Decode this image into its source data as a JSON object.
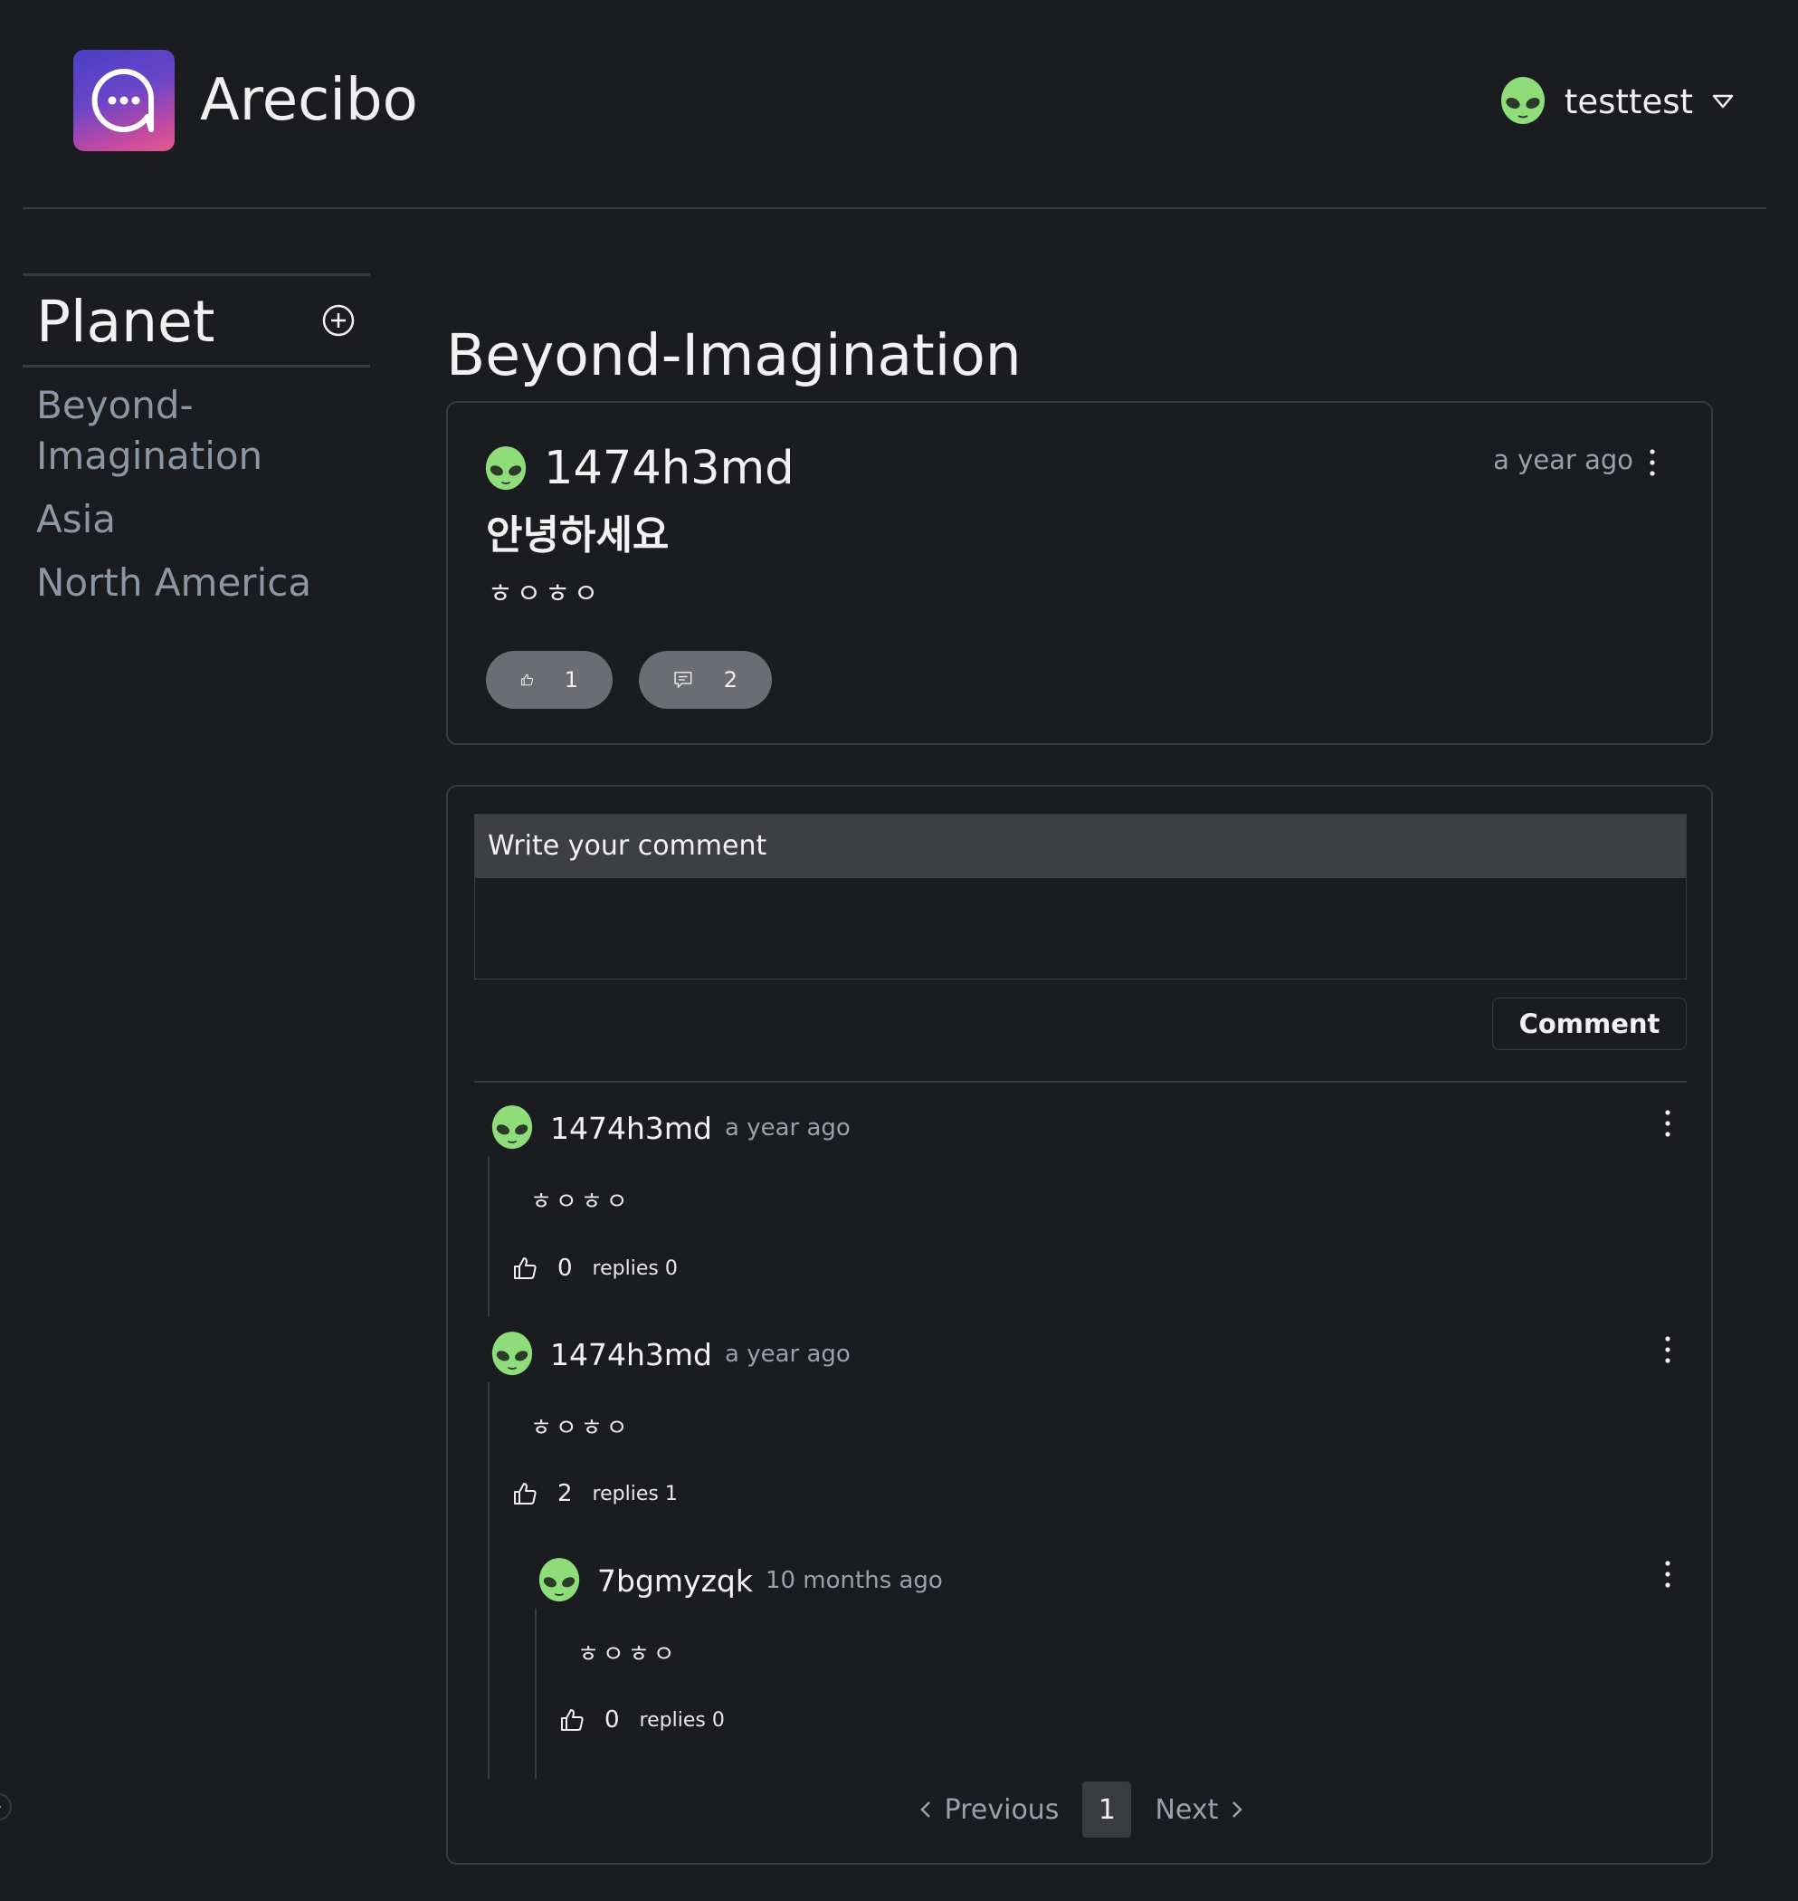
{
  "header": {
    "app_title": "Arecibo",
    "user": {
      "name": "testtest"
    }
  },
  "sidebar": {
    "title": "Planet",
    "items": [
      {
        "label": "Beyond-Imagination"
      },
      {
        "label": "Asia"
      },
      {
        "label": "North America"
      }
    ]
  },
  "main": {
    "title": "Beyond-Imagination",
    "post": {
      "author": "1474h3md",
      "time": "a year ago",
      "title": "안녕하세요",
      "body": "ㅎㅇㅎㅇ",
      "likes": "1",
      "comments": "2"
    },
    "comment_form": {
      "heading": "Write your comment",
      "value": "",
      "submit_label": "Comment"
    },
    "comments": [
      {
        "author": "1474h3md",
        "time": "a year ago",
        "body": "ㅎㅇㅎㅇ",
        "likes": "0",
        "replies": "replies 0"
      },
      {
        "author": "1474h3md",
        "time": "a year ago",
        "body": "ㅎㅇㅎㅇ",
        "likes": "2",
        "replies": "replies 1",
        "children": [
          {
            "author": "7bgmyzqk",
            "time": "10 months ago",
            "body": "ㅎㅇㅎㅇ",
            "likes": "0",
            "replies": "replies 0"
          }
        ]
      }
    ],
    "pagination": {
      "previous_label": "Previous",
      "current": "1",
      "next_label": "Next"
    }
  },
  "colors": {
    "background": "#1b1c1f",
    "border": "#3a3b3f",
    "muted_text": "#9aa1aa",
    "sidebar_link": "#8d96a3",
    "pill": "#6b6d72",
    "avatar_green": "#8fdc7a",
    "logo_gradient_start": "#4a3fc6",
    "logo_gradient_end": "#e45a8f"
  },
  "icons": {
    "logo": "chat-bubble-logo-icon",
    "avatar": "alien-avatar-icon",
    "user_menu": "triangle-down-icon",
    "add": "plus-circle-icon",
    "menu": "vertical-dots-icon",
    "like": "thumbs-up-icon",
    "comment": "comment-bubble-icon",
    "prev": "chevron-left-icon",
    "next": "chevron-right-icon"
  }
}
